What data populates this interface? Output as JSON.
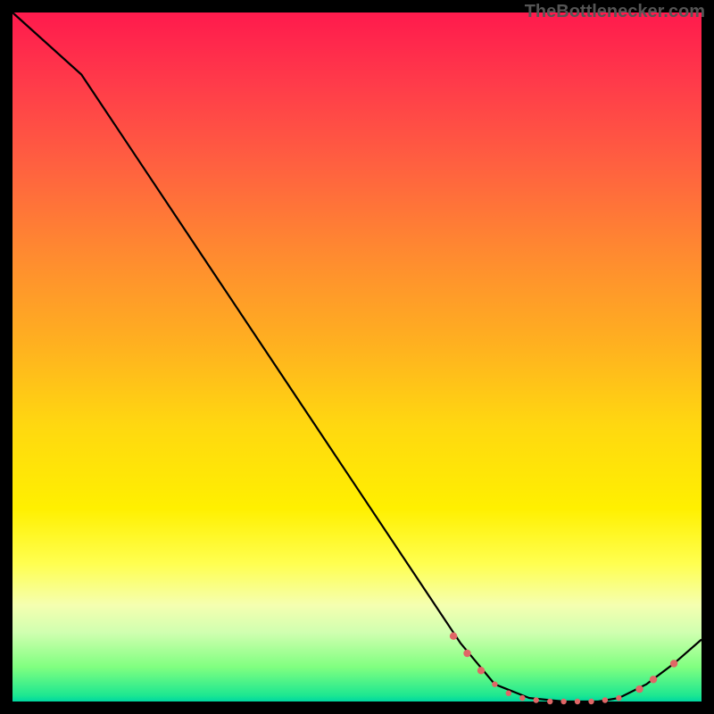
{
  "attribution": "TheBottlenecker.com",
  "chart_data": {
    "type": "line",
    "title": "",
    "xlabel": "",
    "ylabel": "",
    "xlim": [
      0,
      100
    ],
    "ylim": [
      0,
      100
    ],
    "description": "Single black curve over vertical red-to-green gradient. Curve starts near top-left (~100), slight slope change near x≈10, then descends nearly linearly to a flat minimum (~0) around x≈70–88, then rises toward the right edge. Salmon dots mark the curve around the minimum region.",
    "series": [
      {
        "name": "curve",
        "x": [
          0,
          10,
          20,
          30,
          40,
          50,
          60,
          65,
          70,
          75,
          80,
          85,
          88,
          92,
          96,
          100
        ],
        "values": [
          100,
          91,
          76,
          61,
          46,
          31,
          16,
          8.5,
          2.5,
          0.5,
          0,
          0,
          0.5,
          2.5,
          5.5,
          9
        ]
      }
    ],
    "markers": {
      "name": "dots",
      "color": "#e06666",
      "x": [
        64,
        66,
        68,
        70,
        72,
        74,
        76,
        78,
        80,
        82,
        84,
        86,
        88,
        91,
        93,
        96
      ],
      "values": [
        9.5,
        7.0,
        4.5,
        2.5,
        1.2,
        0.5,
        0.2,
        0.0,
        0.0,
        0.0,
        0.0,
        0.2,
        0.5,
        1.8,
        3.2,
        5.5
      ]
    }
  }
}
